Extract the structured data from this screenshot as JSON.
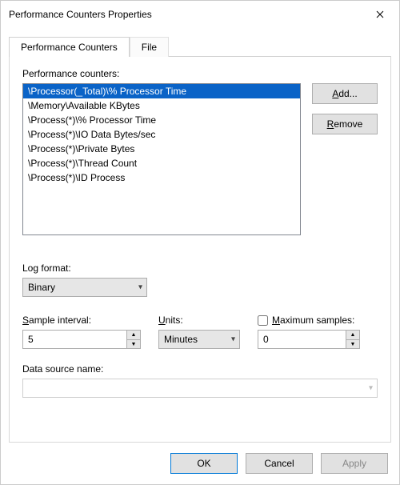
{
  "window": {
    "title": "Performance Counters Properties"
  },
  "tabs": {
    "active": "Performance Counters",
    "inactive": "File"
  },
  "counters": {
    "label": "Performance counters:",
    "items": [
      "\\Processor(_Total)\\% Processor Time",
      "\\Memory\\Available KBytes",
      "\\Process(*)\\% Processor Time",
      "\\Process(*)\\IO Data Bytes/sec",
      "\\Process(*)\\Private Bytes",
      "\\Process(*)\\Thread Count",
      "\\Process(*)\\ID Process"
    ],
    "selected_index": 0,
    "add_label": "Add...",
    "remove_label": "Remove"
  },
  "log_format": {
    "label": "Log format:",
    "value": "Binary"
  },
  "sample_interval": {
    "label": "Sample interval:",
    "value": "5"
  },
  "units": {
    "label": "Units:",
    "value": "Minutes"
  },
  "max_samples": {
    "label": "Maximum samples:",
    "checked": false,
    "value": "0"
  },
  "data_source": {
    "label": "Data source name:",
    "value": ""
  },
  "footer": {
    "ok": "OK",
    "cancel": "Cancel",
    "apply": "Apply"
  }
}
